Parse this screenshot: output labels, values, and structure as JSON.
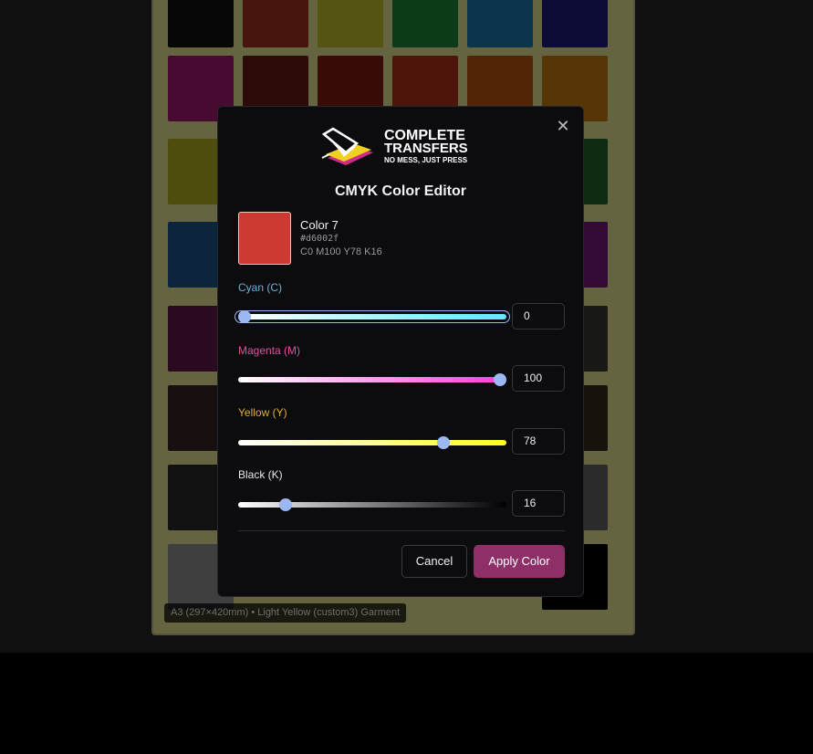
{
  "canvas": {
    "garment_color": "#fafaa0",
    "info_label": "A3 (297×420mm) • Light Yellow (custom3) Garment",
    "swatch_colors": [
      [
        "#131313",
        "#b43325",
        "#d2d231",
        "#21913f",
        "#1f86c1",
        "#1d1d85"
      ],
      [
        "#b21c7b",
        "#6b1a12",
        "#8c1b14",
        "#c2351a",
        "#cd5c13",
        "#d88413"
      ],
      [
        "#c1c125",
        null,
        null,
        null,
        null,
        "#1f6b28"
      ],
      [
        "#1f5e96",
        null,
        null,
        null,
        null,
        "#7c1d87"
      ],
      [
        "#6d1a4f",
        null,
        null,
        null,
        null,
        "#3c3c34"
      ],
      [
        "#3c2828",
        null,
        null,
        null,
        null,
        "#3c2f22"
      ],
      [
        "#2e2e2e",
        null,
        null,
        null,
        null,
        "#6c6c6c"
      ],
      [
        "#9d9d9d",
        null,
        null,
        null,
        null,
        "#000000"
      ]
    ]
  },
  "dialog": {
    "close_glyph": "✕",
    "logo": {
      "line1": "COMPLETE",
      "line2": "TRANSFERS",
      "tagline": "NO MESS, JUST PRESS"
    },
    "title": "CMYK Color Editor",
    "color": {
      "name": "Color 7",
      "hex": "#d6002f",
      "cmyk_text": "C0 M100 Y78 K16",
      "preview_swatch": "#cc3a31"
    },
    "channels": [
      {
        "key": "cyan",
        "label": "Cyan (C)",
        "value": "0",
        "label_color": "#6ab0dc",
        "gradient": [
          "#ffffff",
          "#5fe8ff"
        ]
      },
      {
        "key": "magenta",
        "label": "Magenta (M)",
        "value": "100",
        "label_color": "#e0509a",
        "gradient": [
          "#ffffff",
          "#ff3cdc"
        ]
      },
      {
        "key": "yellow",
        "label": "Yellow (Y)",
        "value": "78",
        "label_color": "#e0b032",
        "gradient": [
          "#ffffff",
          "#ffff22"
        ]
      },
      {
        "key": "black",
        "label": "Black (K)",
        "value": "16",
        "label_color": "#e8e8e8",
        "gradient": [
          "#ffffff",
          "#000000"
        ]
      }
    ],
    "cancel_label": "Cancel",
    "apply_label": "Apply Color"
  }
}
